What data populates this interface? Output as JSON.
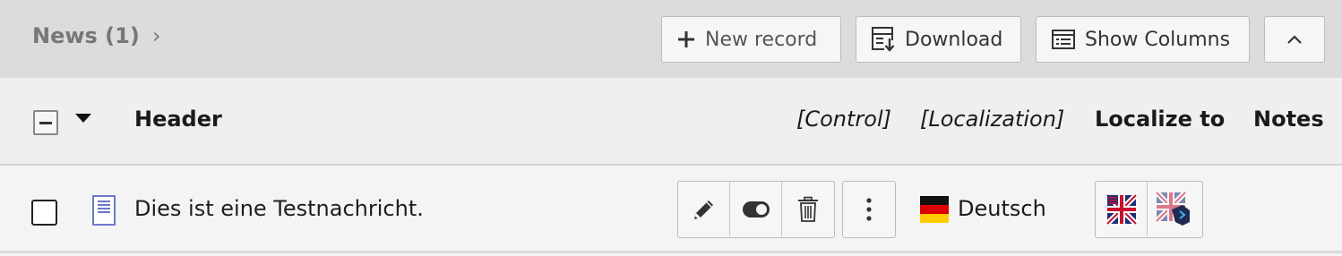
{
  "header": {
    "title": "News (1)",
    "chevron": "›",
    "new_record_label": "New record",
    "download_label": "Download",
    "show_columns_label": "Show Columns",
    "collapse_icon": "chevron-up-icon"
  },
  "columns": {
    "header": "Header",
    "control": "[Control]",
    "localization": "[Localization]",
    "localize_to": "Localize to",
    "notes": "Notes"
  },
  "rows": [
    {
      "title": "Dies ist eine Testnachricht.",
      "language": "Deutsch",
      "actions": [
        "edit-icon",
        "toggle-visibility-icon",
        "delete-icon",
        "more-icon"
      ],
      "localize_to": [
        "flag-en-icon",
        "flag-en-translate-icon"
      ]
    }
  ],
  "colors": {
    "header_bg": "#dcdcdc",
    "table_bg": "#f3f3f3",
    "border": "#bcbcbc",
    "doc_icon": "#6c78c8"
  }
}
